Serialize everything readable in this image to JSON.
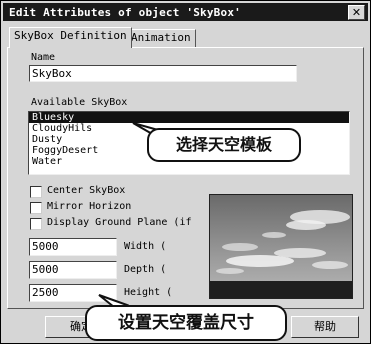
{
  "window": {
    "title": "Edit Attributes of object 'SkyBox'",
    "close_glyph": "✕"
  },
  "tabs": [
    {
      "label": "SkyBox Definition",
      "active": true
    },
    {
      "label": "Animation",
      "active": false
    }
  ],
  "name_field": {
    "label": "Name",
    "value": "SkyBox"
  },
  "skybox_list": {
    "label": "Available SkyBox",
    "items": [
      "Bluesky",
      "CloudyHils",
      "Dusty",
      "FoggyDesert",
      "Water"
    ],
    "selected": "Bluesky"
  },
  "checkboxes": [
    {
      "label": "Center SkyBox",
      "checked": false
    },
    {
      "label": "Mirror Horizon",
      "checked": false
    },
    {
      "label": "Display Ground Plane (if",
      "checked": false
    }
  ],
  "dimensions": [
    {
      "value": "5000",
      "label": "Width ("
    },
    {
      "value": "5000",
      "label": "Depth ("
    },
    {
      "value": "2500",
      "label": "Height ("
    }
  ],
  "buttons": {
    "ok": "确定",
    "help": "帮助"
  },
  "annotations": {
    "select_template": "选择天空模板",
    "set_size": "设置天空覆盖尺寸"
  },
  "colors": {
    "titlebar": "#1a1a1a",
    "selection": "#111111",
    "face": "#d6d6d6"
  }
}
